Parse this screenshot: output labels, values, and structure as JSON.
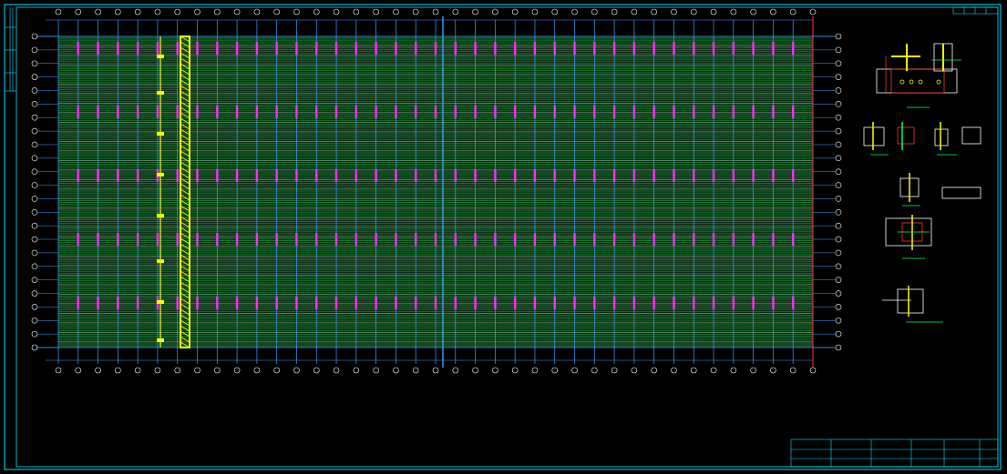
{
  "drawing": {
    "plan_title": "",
    "notes_heading": "",
    "notes": []
  },
  "colors": {
    "background": "#000000",
    "frame": "#00e5ff",
    "grid_axis": "#3da0ff",
    "purlin": "#1e8c3a",
    "rafter_highlight": "#ff2bff",
    "bracing_yellow": "#f5ff00",
    "axis_bubble": "#ffffff",
    "title_block": "#00e5ff"
  },
  "icons": [
    "axis-bubble-icon",
    "section-detail-icon"
  ],
  "grid": {
    "columns": 39,
    "rows": 24
  }
}
